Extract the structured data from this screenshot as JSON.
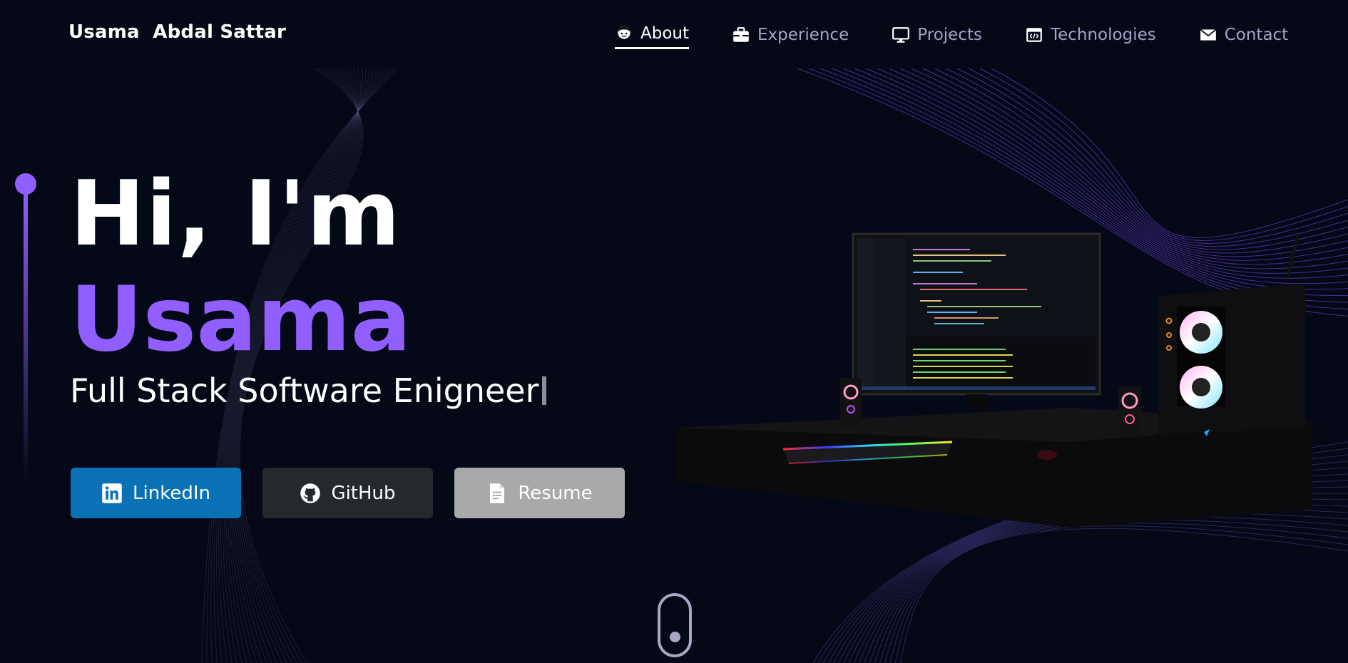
{
  "brand": "Usama  Abdal Sattar",
  "nav": {
    "items": [
      {
        "label": "About",
        "icon": "avatar-icon",
        "active": true
      },
      {
        "label": "Experience",
        "icon": "briefcase-icon",
        "active": false
      },
      {
        "label": "Projects",
        "icon": "monitor-icon",
        "active": false
      },
      {
        "label": "Technologies",
        "icon": "code-window-icon",
        "active": false
      },
      {
        "label": "Contact",
        "icon": "envelope-icon",
        "active": false
      }
    ]
  },
  "hero": {
    "greeting": "Hi, I'm",
    "name": "Usama",
    "role": "Full Stack Software Enigneer"
  },
  "buttons": {
    "linkedin": "LinkedIn",
    "github": "GitHub",
    "resume": "Resume"
  },
  "colors": {
    "background": "#050816",
    "accent": "#915eff",
    "linkedin": "#0a72b4",
    "github": "#24292e",
    "resume": "#a9a9a9",
    "nav_text": "#a9a1c8"
  }
}
